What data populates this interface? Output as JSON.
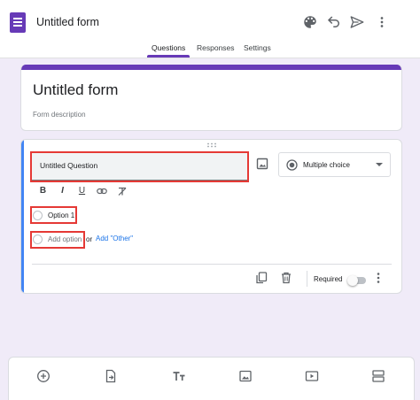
{
  "header": {
    "app_title": "Untitled form",
    "icons": [
      "palette-icon",
      "undo-icon",
      "send-icon",
      "more-vert-icon"
    ],
    "tabs": [
      {
        "label": "Questions",
        "active": true
      },
      {
        "label": "Responses",
        "active": false
      },
      {
        "label": "Settings",
        "active": false
      }
    ]
  },
  "form": {
    "title": "Untitled form",
    "description": "Form description"
  },
  "question": {
    "title": "Untitled Question",
    "type": "Multiple choice",
    "formatting": [
      "B",
      "I",
      "U",
      "link",
      "clear-format"
    ],
    "options": [
      "Option 1"
    ],
    "add_option_label": "Add option",
    "or_label": "or",
    "add_other_label": "Add \"Other\"",
    "required_label": "Required",
    "required": false
  },
  "toolbar": {
    "icons": [
      "add-question-icon",
      "import-questions-icon",
      "add-title-icon",
      "add-image-icon",
      "add-video-icon",
      "add-section-icon"
    ]
  },
  "colors": {
    "theme_purple": "#673ab7",
    "active_question_blue": "#4285f4",
    "highlight_red": "#e53935",
    "link_blue": "#1a73e8",
    "canvas_background": "#f0ebf8"
  }
}
